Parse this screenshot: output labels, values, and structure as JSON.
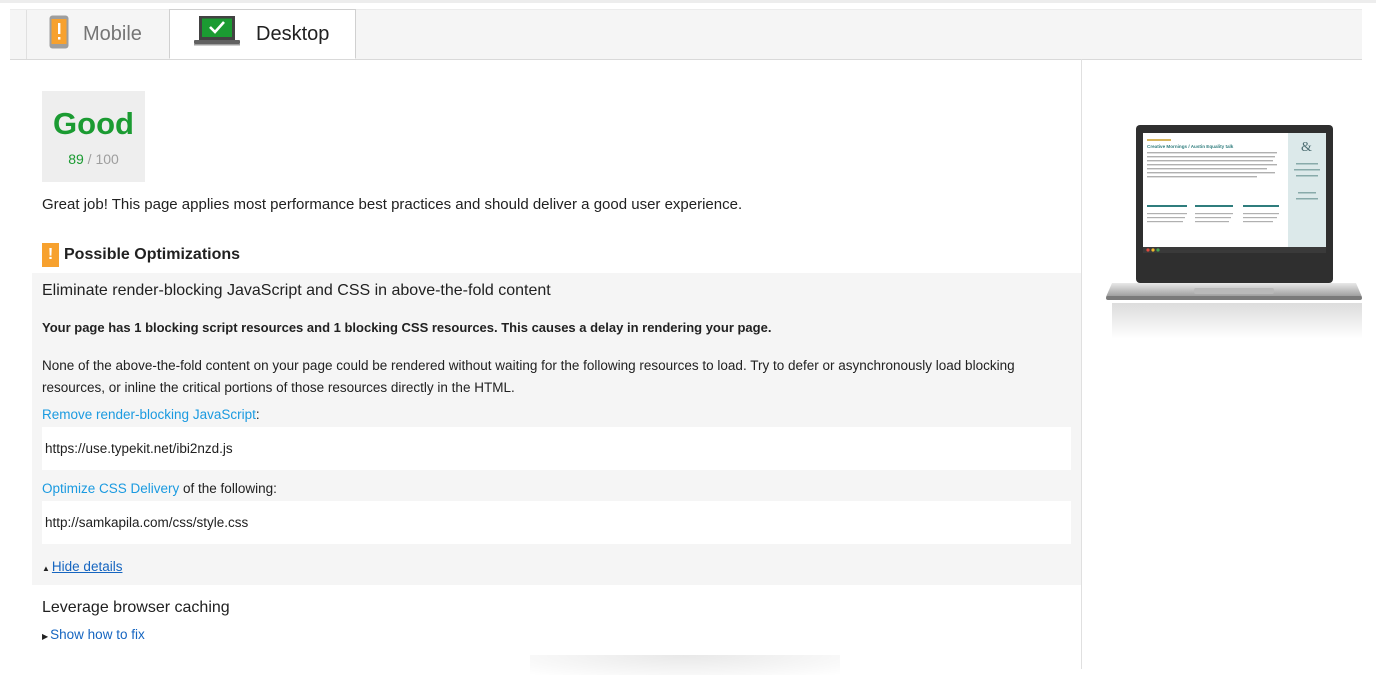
{
  "tabs": {
    "mobile_label": "Mobile",
    "desktop_label": "Desktop"
  },
  "score": {
    "rating": "Good",
    "value": "89",
    "separator": "/",
    "max": "100",
    "color": "#1b9b32"
  },
  "summary_text": "Great job! This page applies most performance best practices and should deliver a good user experience.",
  "optimizations": {
    "heading": "Possible Optimizations",
    "warning_glyph": "!",
    "accent": "#f7a12e"
  },
  "rule1": {
    "title": "Eliminate render-blocking JavaScript and CSS in above-the-fold content",
    "summary_bold": "Your page has 1 blocking script resources and 1 blocking CSS resources. This causes a delay in rendering your page.",
    "description": "None of the above-the-fold content on your page could be rendered without waiting for the following resources to load. Try to defer or asynchronously load blocking resources, or inline the critical portions of those resources directly in the HTML.",
    "js_link": "Remove render-blocking JavaScript",
    "js_suffix": ":",
    "js_url": "https://use.typekit.net/ibi2nzd.js",
    "css_link": "Optimize CSS Delivery",
    "css_suffix": " of the following:",
    "css_url": "http://samkapila.com/css/style.css",
    "toggle_glyph": "▲",
    "toggle_label": "Hide details"
  },
  "rule2": {
    "title": "Leverage browser caching",
    "toggle_glyph": "▶",
    "toggle_label": "Show how to fix"
  },
  "preview": {
    "site_heading": "Creative Mornings / Austin Equality talk",
    "logo_glyph": "&"
  }
}
